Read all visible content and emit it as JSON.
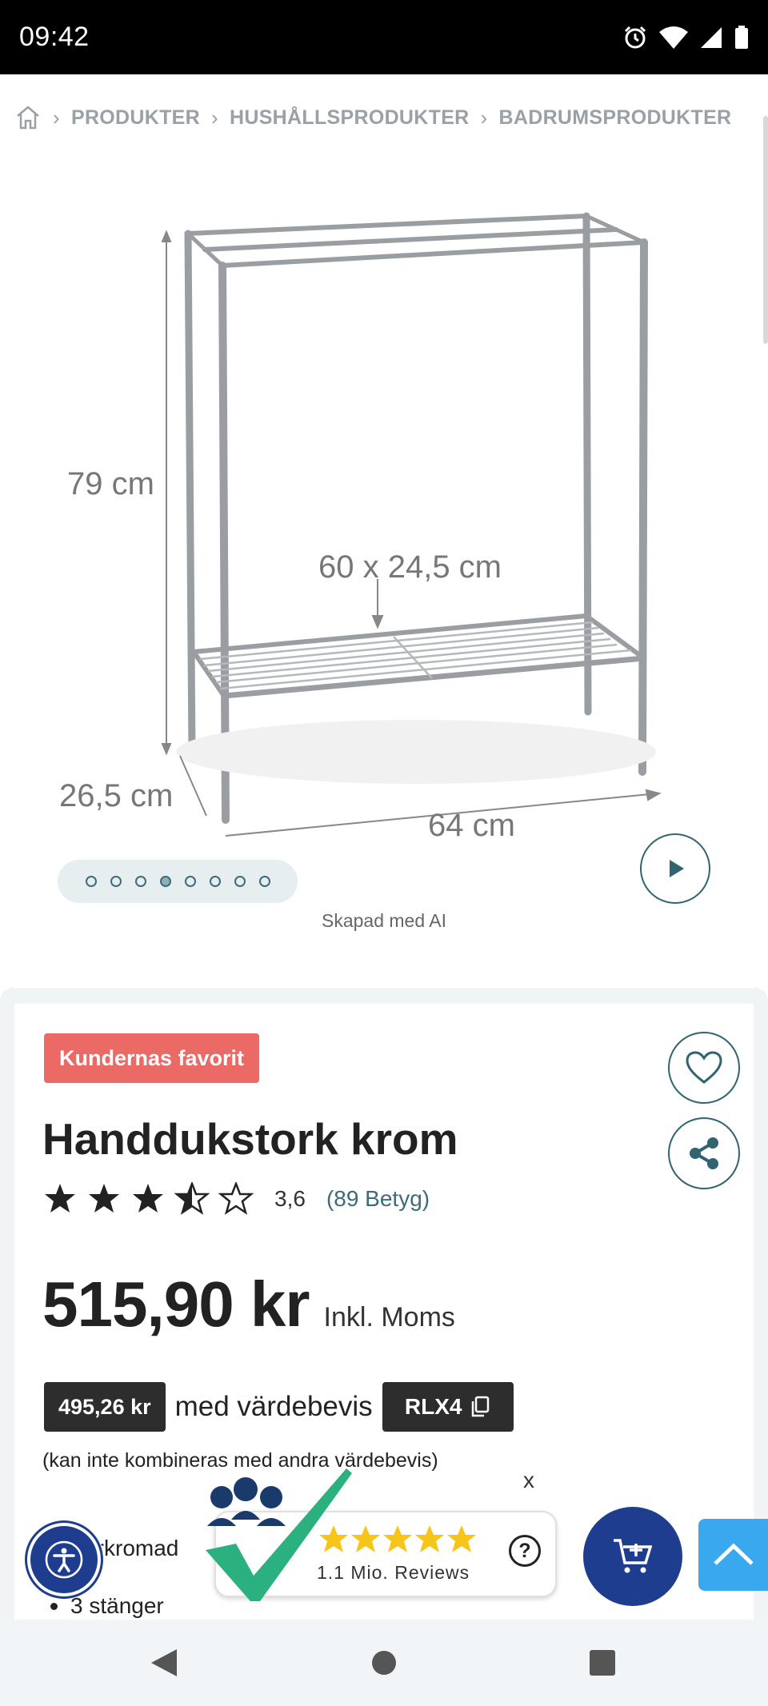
{
  "status_bar": {
    "time": "09:42"
  },
  "breadcrumb": {
    "items": [
      "PRODUKTER",
      "HUSHÅLLSPRODUKTER",
      "BADRUMSPRODUKTER"
    ]
  },
  "product_image": {
    "dimensions": {
      "height": "79 cm",
      "shelf": "60 x 24,5 cm",
      "depth": "26,5 cm",
      "width": "64 cm"
    },
    "dot_count": 8,
    "active_dot": 4,
    "ai_note": "Skapad med AI"
  },
  "product": {
    "badge": "Kundernas favorit",
    "title": "Handdukstork krom",
    "rating": {
      "value": "3,6",
      "count_label": "(89 Betyg)",
      "stars_value": 3.6
    },
    "price": "515,90 kr",
    "price_note": "Inkl. Moms",
    "voucher": {
      "price": "495,26 kr",
      "text": "med värdebevis",
      "code": "RLX4",
      "note": "(kan inte kombineras med andra värdebevis)"
    },
    "features": [
      "Förkromad",
      "3 stänger"
    ]
  },
  "reviews_widget": {
    "label": "1.1 Mio. Reviews",
    "close": "x",
    "help": "?"
  },
  "colors": {
    "accent": "#2f6470",
    "badge": "#ec6a66",
    "fab": "#1f3d8f",
    "scroll_top": "#3aa8ef",
    "star": "#f5c518"
  },
  "icons": {
    "home": "home-icon",
    "wishlist": "heart-icon",
    "share": "share-icon",
    "copy": "copy-icon",
    "play": "play-icon",
    "cart": "add-to-cart-icon",
    "accessibility": "accessibility-icon",
    "top": "chevron-up-icon"
  }
}
